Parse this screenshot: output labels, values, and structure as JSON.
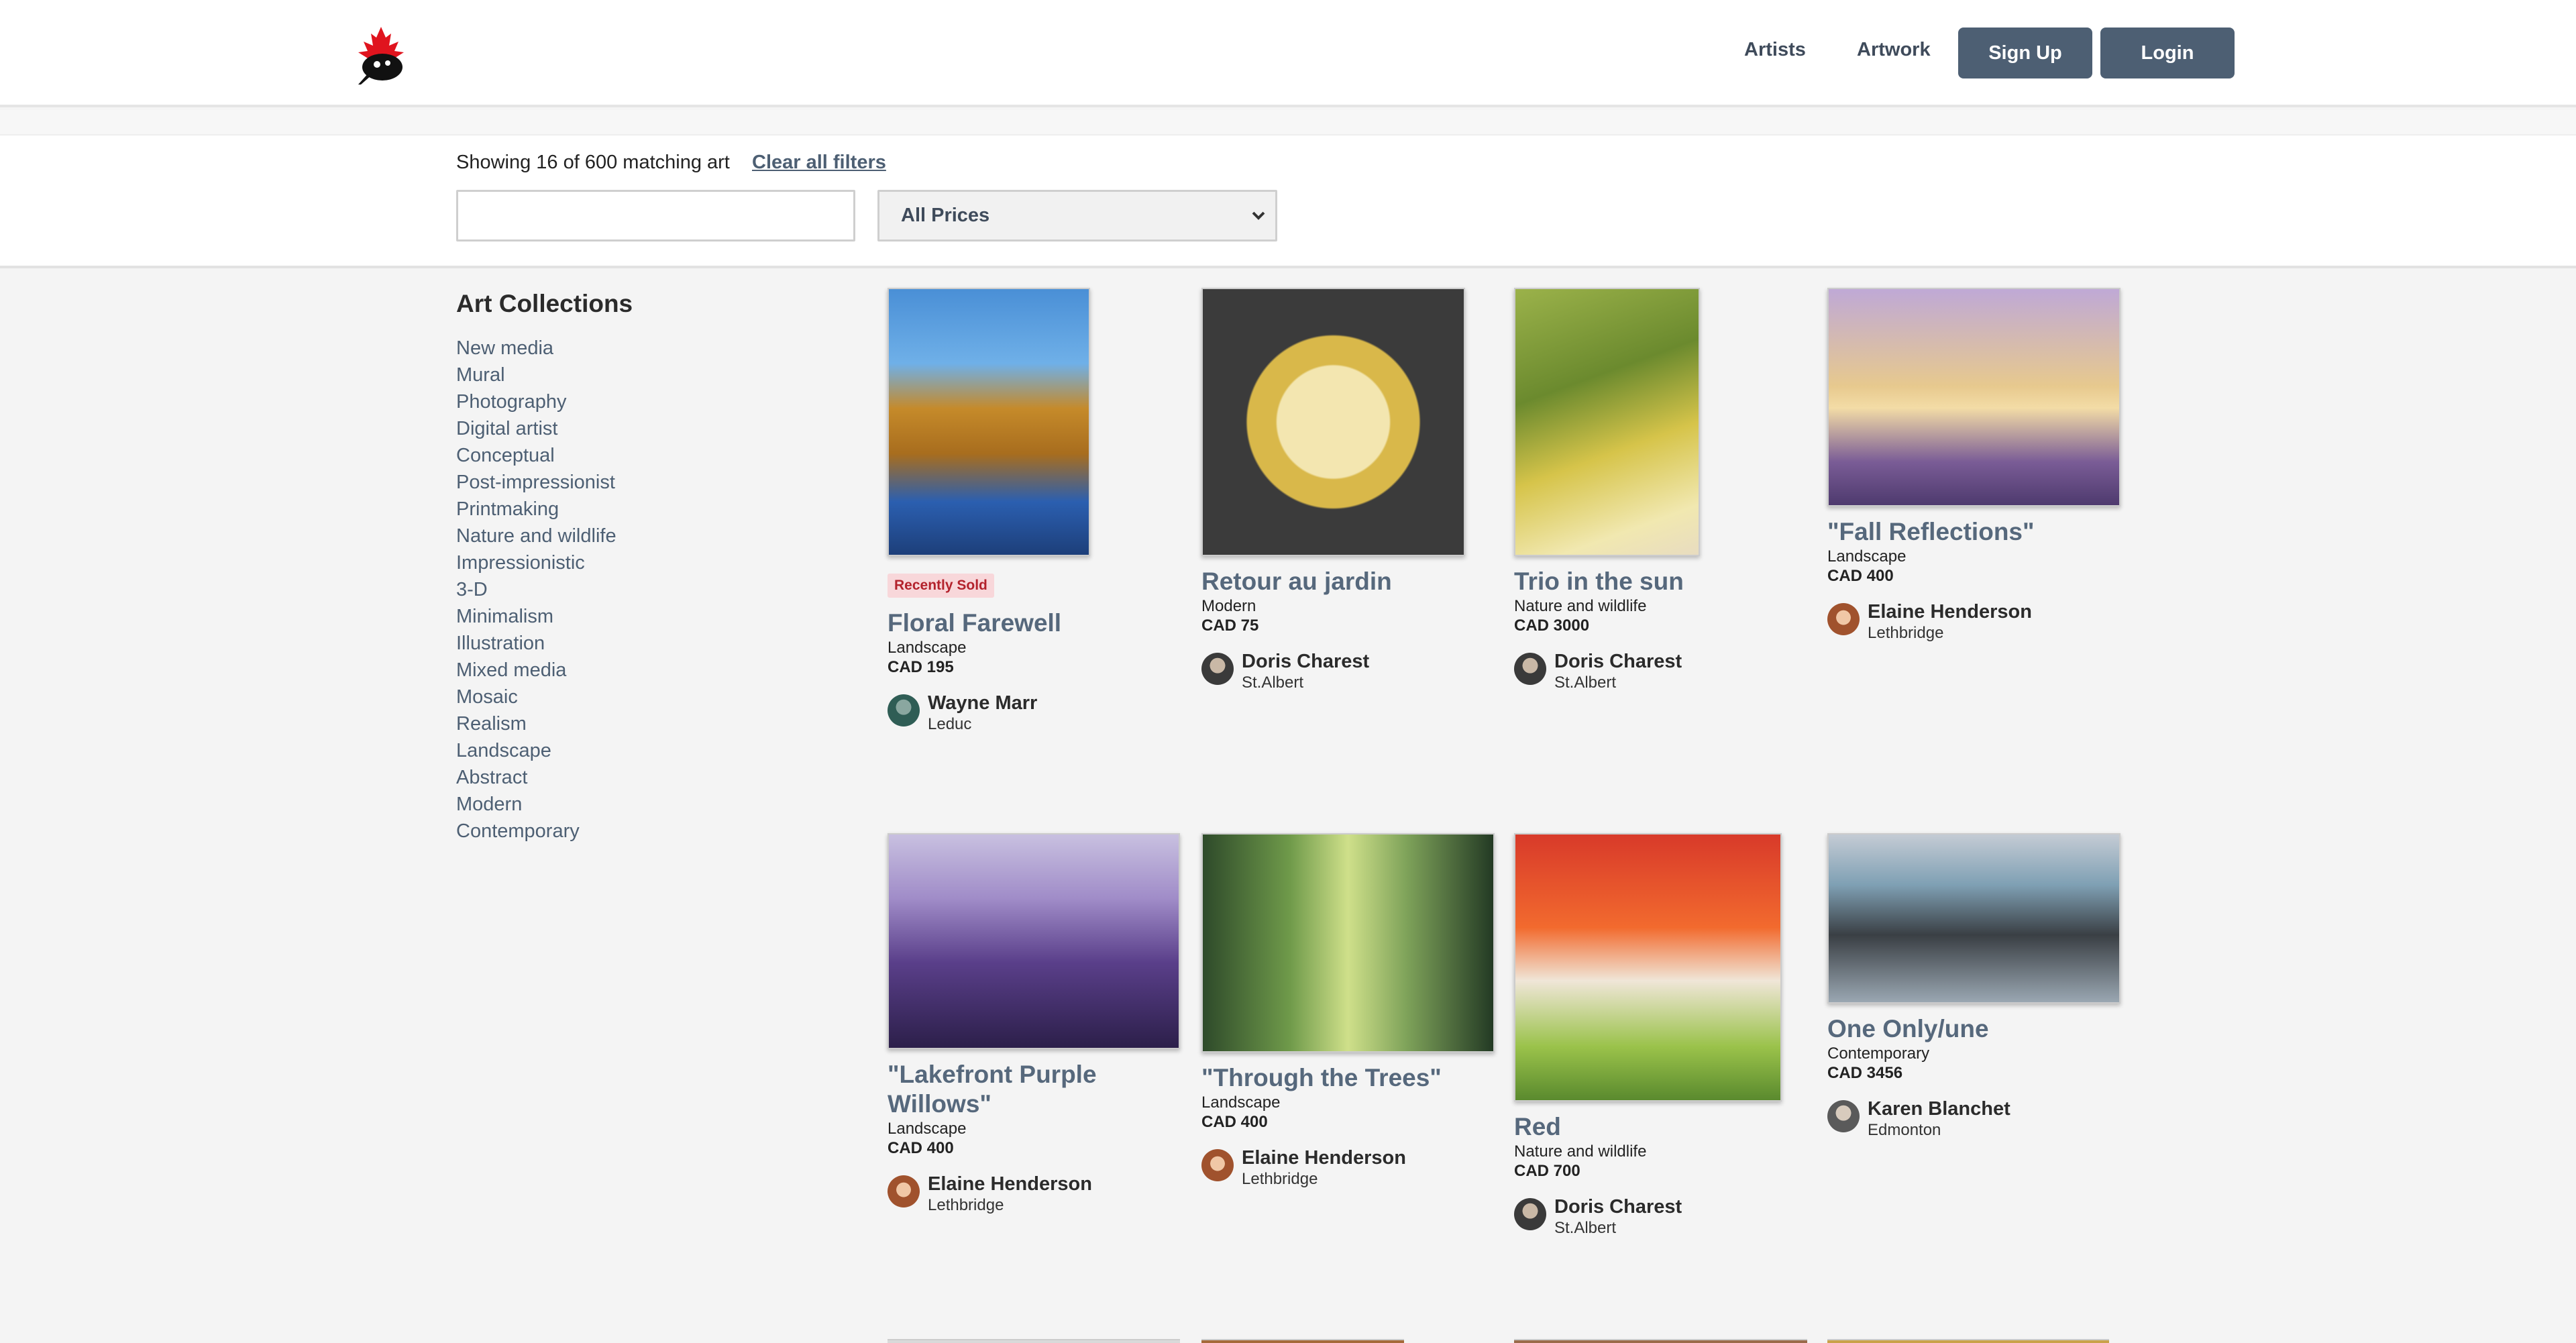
{
  "header": {
    "nav": [
      {
        "label": "Artists"
      },
      {
        "label": "Artwork"
      }
    ],
    "signup_label": "Sign Up",
    "login_label": "Login"
  },
  "filters": {
    "results_text": "Showing 16 of 600 matching art",
    "clear_label": "Clear all filters",
    "search_value": "",
    "price_selected": "All Prices"
  },
  "sidebar": {
    "title": "Art Collections",
    "items": [
      {
        "label": "New media"
      },
      {
        "label": "Mural"
      },
      {
        "label": "Photography"
      },
      {
        "label": "Digital artist"
      },
      {
        "label": "Conceptual"
      },
      {
        "label": "Post-impressionist"
      },
      {
        "label": "Printmaking"
      },
      {
        "label": "Nature and wildlife"
      },
      {
        "label": "Impressionistic"
      },
      {
        "label": "3-D"
      },
      {
        "label": "Minimalism"
      },
      {
        "label": "Illustration"
      },
      {
        "label": "Mixed media"
      },
      {
        "label": "Mosaic"
      },
      {
        "label": "Realism"
      },
      {
        "label": "Landscape"
      },
      {
        "label": "Abstract"
      },
      {
        "label": "Modern"
      },
      {
        "label": "Contemporary"
      }
    ]
  },
  "artworks": [
    {
      "title": "Floral Farewell",
      "badge": "Recently Sold",
      "category": "Landscape",
      "price": "CAD 195",
      "artist": "Wayne Marr",
      "city": "Leduc"
    },
    {
      "title": "Retour au jardin",
      "category": "Modern",
      "price": "CAD 75",
      "artist": "Doris Charest",
      "city": "St.Albert"
    },
    {
      "title": "Trio in the sun",
      "category": "Nature and wildlife",
      "price": "CAD 3000",
      "artist": "Doris Charest",
      "city": "St.Albert"
    },
    {
      "title": "\"Fall Reflections\"",
      "category": "Landscape",
      "price": "CAD 400",
      "artist": "Elaine Henderson",
      "city": "Lethbridge"
    },
    {
      "title": "\"Lakefront Purple Willows\"",
      "category": "Landscape",
      "price": "CAD 400",
      "artist": "Elaine Henderson",
      "city": "Lethbridge"
    },
    {
      "title": "\"Through the Trees\"",
      "category": "Landscape",
      "price": "CAD 400",
      "artist": "Elaine Henderson",
      "city": "Lethbridge"
    },
    {
      "title": "Red",
      "category": "Nature and wildlife",
      "price": "CAD 700",
      "artist": "Doris Charest",
      "city": "St.Albert"
    },
    {
      "title": "One Only/une",
      "category": "Contemporary",
      "price": "CAD 3456",
      "artist": "Karen Blanchet",
      "city": "Edmonton"
    }
  ]
}
